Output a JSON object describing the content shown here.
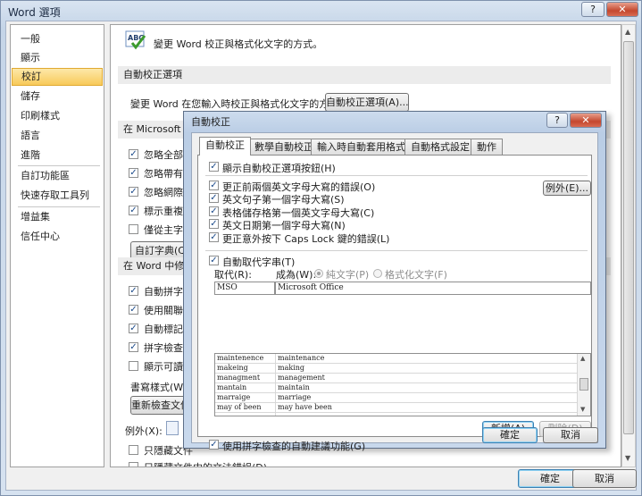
{
  "outer_window": {
    "title": "Word 選項",
    "help_btn": "?",
    "close_btn": "✕"
  },
  "nav": {
    "items": [
      "一般",
      "顯示",
      "校訂",
      "儲存",
      "印刷樣式",
      "語言",
      "進階",
      "自訂功能區",
      "快速存取工具列",
      "增益集",
      "信任中心"
    ],
    "selected": "校訂"
  },
  "content": {
    "header_text": "變更 Word 校正與格式化文字的方式。",
    "section1_title": "自動校正選項",
    "section1_text": "變更 Word 在您輸入時校正與格式化文字的方式:",
    "autocorrect_options_button": "自動校正選項(A)...",
    "section2_title_partial": "在 Microsoft O",
    "section2_items": [
      "忽略全部大",
      "忽略帶有數",
      "忽略網際網",
      "標示重複的",
      "僅從主字典"
    ],
    "custom_dict_button": "自訂字典(C",
    "section3_title_partial": "在 Word 中修正",
    "section3_items": [
      "自動拼字檢",
      "使用關聯式",
      "自動標記文",
      "拼字檢查與",
      "顯示可讀性"
    ],
    "writing_style_label": "書寫樣式(W):",
    "recheck_button": "重新檢查文件",
    "exceptions_label": "例外(X):",
    "bottom_items": [
      "只隱藏文件",
      "只隱藏文件中的文法錯誤(D)"
    ]
  },
  "outer_buttons": {
    "ok": "確定",
    "cancel": "取消"
  },
  "dialog": {
    "title": "自動校正",
    "help_btn": "?",
    "close_btn": "✕",
    "tabs": [
      "自動校正",
      "數學自動校正",
      "輸入時自動套用格式",
      "自動格式設定",
      "動作"
    ],
    "selected_tab": "自動校正",
    "show_buttons_label": "顯示自動校正選項按鈕(H)",
    "options": [
      "更正前兩個英文字母大寫的錯誤(O)",
      "英文句子第一個字母大寫(S)",
      "表格儲存格第一個英文字母大寫(C)",
      "英文日期第一個字母大寫(N)",
      "更正意外按下 Caps Lock 鍵的錯誤(L)"
    ],
    "exceptions_button": "例外(E)...",
    "replace_as_you_type_label": "自動取代字串(T)",
    "replace_label": "取代(R):",
    "with_label": "成為(W):",
    "plain_text_label": "純文字(P)",
    "formatted_text_label": "格式化文字(F)",
    "replace_value": "MSO",
    "with_value": "Microsoft Office",
    "list_rows": [
      {
        "from": "maintenence",
        "to": "maintenance"
      },
      {
        "from": "makeing",
        "to": "making"
      },
      {
        "from": "managment",
        "to": "management"
      },
      {
        "from": "mantain",
        "to": "maintain"
      },
      {
        "from": "marraige",
        "to": "marriage"
      },
      {
        "from": "may of been",
        "to": "may have been"
      }
    ],
    "add_button": "新增(A)",
    "delete_button": "刪除(D)",
    "spell_suggest_label": "使用拼字檢查的自動建議功能(G)",
    "ok_button": "確定",
    "cancel_button": "取消"
  }
}
